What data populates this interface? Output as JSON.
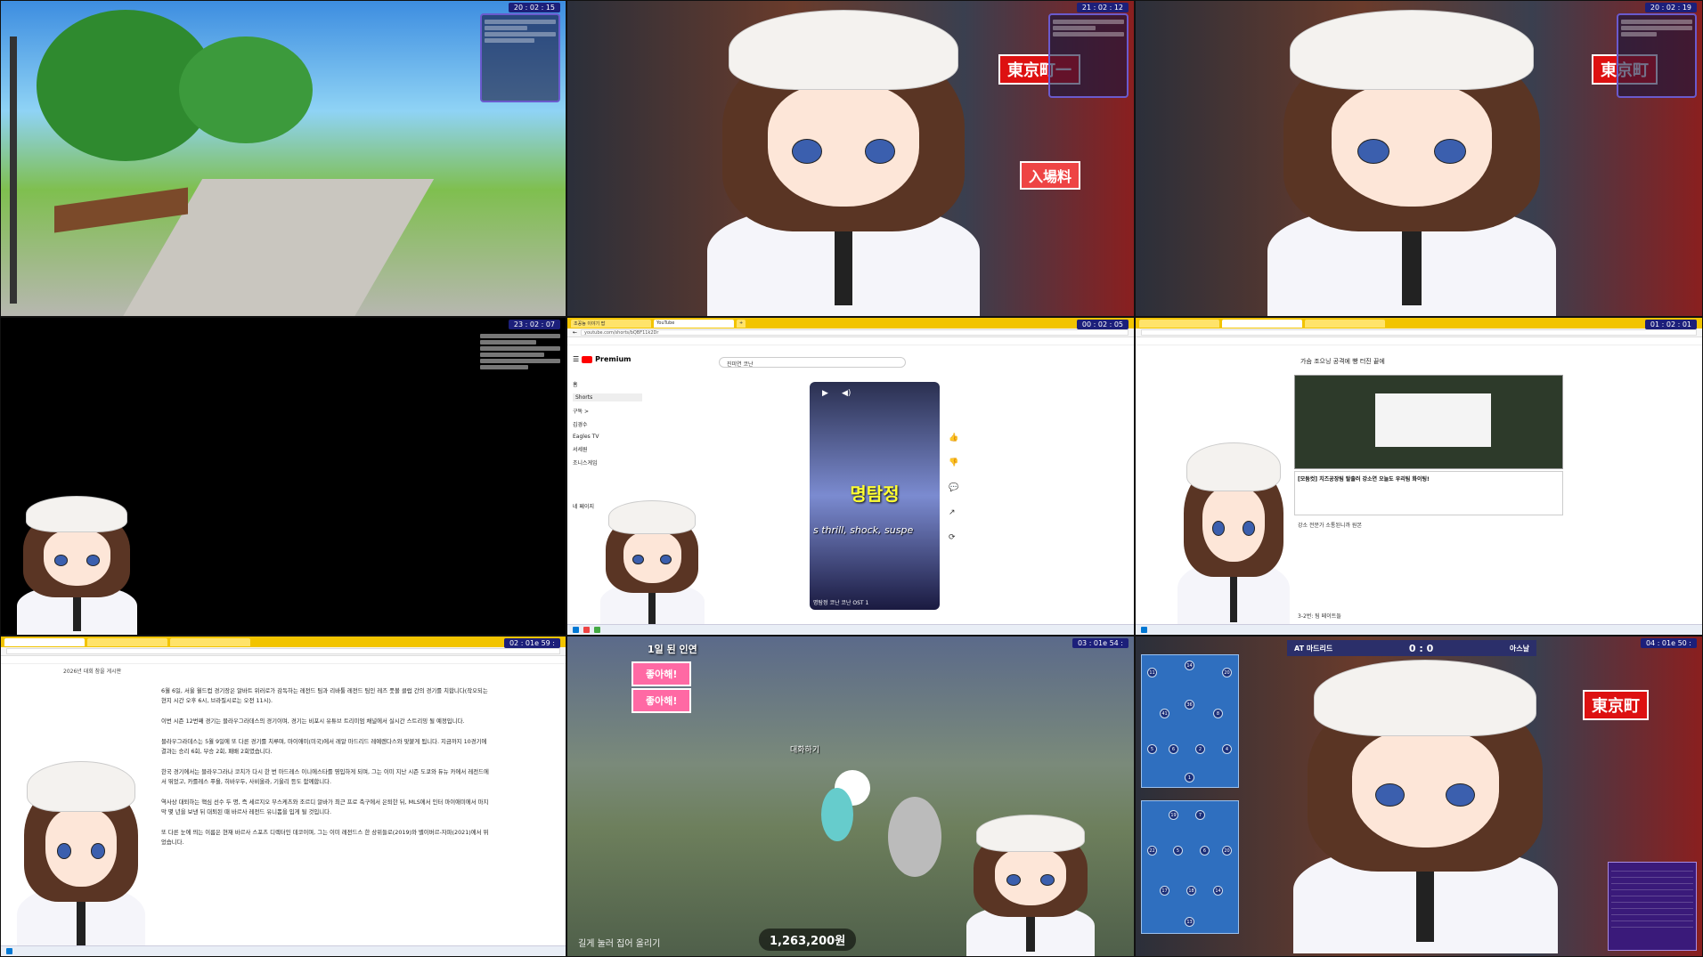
{
  "cells": {
    "c1": {
      "clock": "20 : 02 : 15"
    },
    "c2": {
      "clock": "21 : 02 : 12",
      "sign": "東京町一",
      "sign2": "入場料"
    },
    "c3": {
      "clock": "20 : 02 : 19",
      "sign": "東京町"
    },
    "c4": {
      "clock": "23 : 02 : 07"
    },
    "c5": {
      "clock": "00 : 02 : 05",
      "tabs": [
        "조꽁뇽 이야기 팝 ",
        "YouTube",
        "+"
      ],
      "url": "youtube.com/shorts/bQBF11k2Dr",
      "brand": "Premium",
      "search": "진미연 코난",
      "side": [
        "홈",
        "Shorts",
        "구독 >",
        "김경수",
        "Eagles TV",
        "서세원",
        "조니스게임",
        "네 페이지"
      ],
      "short_title": "명탐정",
      "short_sub": "s thrill, shock, suspe",
      "short_caption": "명탐정 코난 코난 OST 1"
    },
    "c6": {
      "clock": "01 : 02 : 01",
      "heading": "가슴 조으닝 공격에 빵 터진 끝에",
      "caption": "[모둠컷] 치즈공장팀 탈출러 강소연 오늘도 우리팀 화이팅!",
      "footer": "강소 전문가 소통된니까 원본",
      "footer2": "3-2번: 팀 페이트들"
    },
    "c7": {
      "clock": "02 : 01e 59 :",
      "board": "2026년 대회 참을 게시판",
      "p1": "6월 6일, 서울 월드컵 경기장은 알바트 위러로가 감독하는 레전드 팀과 리바툴 레전드 팀인 레즈 풋볼 클럽 간의 경기를 치합니다(작오되는 현지 시간 오후 6시, 브라질시로는 오전 11시).",
      "p2": "이번 시즌 12번째 경기는 블라우그라데스의 경기이며, 경기는 비포시 유튜브 트리미엄 채널에서 실시간 스트리밍 될 예정입니다.",
      "p3": "블라우그라데스는 5월 9일에 또 다른 경기를 치루며, 마이애미(미국)에서 레알 마드리드 레예렌다스와 맞붙게 됩니다. 지금까지 10경기에 결과는 승리 6회, 무승 2회, 패배 2회였습니다.",
      "p4": "한국 경기에서는 블라우그라나 코치가 다시 한 번 마드레스 이니에스타를 영입하게 되며, 그는 이미 지난 시즌 도쿄와 듀뉴 카에서 레전드에서 뛰었고, 카를레스 푸욜, 히바우두, 사비올라, 기울리 등도 함께합니다.",
      "p5": "역사상 대퇴하는 핵심 선수 두 명, 즉 세르지오 부스케츠와 조르디 알바가 최근 프로 축구에서 은퇴한 뒤, MLS에서 인터 마이애미에서 마지막 몇 년을 보낸 뒤 대퇴된 때 바르사 레전드 유니폼을 입게 될 것입니다.",
      "p6": "또 다른 눈에 띄는 이름은 현재 바르사 스포츠 디렉터인 데코이며, 그는 이미 레전드스 한 상위들로(2019)와 밸이버르-자파(2021)에서 뛰었습니다."
    },
    "c8": {
      "clock": "03 : 01e 54 :",
      "top": "1일 된 인연",
      "btn1": "좋아해!",
      "btn2": "좋아해!",
      "label": "대화하기",
      "hint": "길게 눌러 집어 올리기",
      "coins": "1,263,200원"
    },
    "c9": {
      "clock": "04 : 01e 50 :",
      "home": "AT 마드리드",
      "score": "0 : 0",
      "away": "아스날",
      "sign": "東京町"
    }
  }
}
